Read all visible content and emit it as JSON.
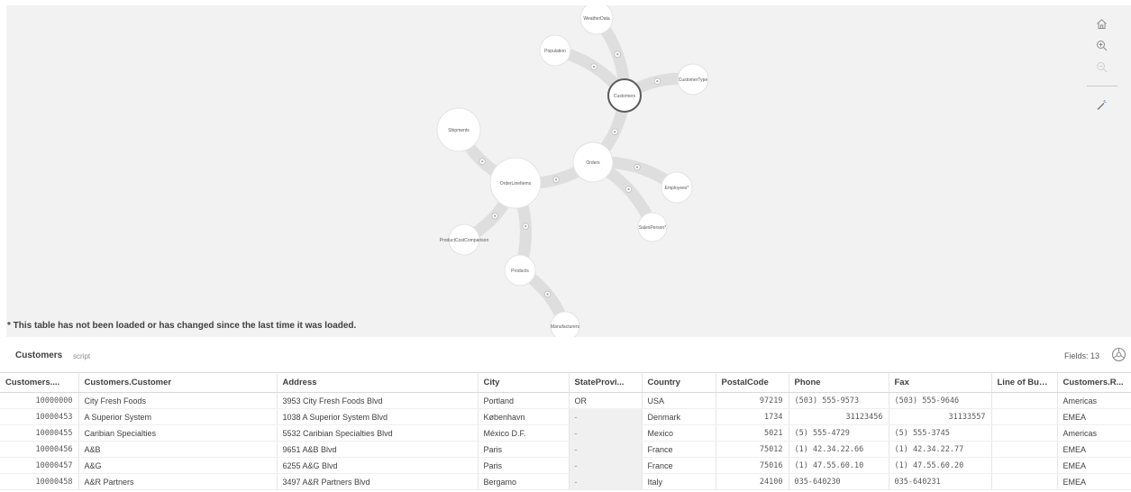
{
  "warning": "* This table has not been loaded or has changed since the last time it was loaded.",
  "model": {
    "nodes": [
      {
        "id": "weatherdata",
        "label": "WeatherData"
      },
      {
        "id": "population",
        "label": "Population"
      },
      {
        "id": "customers",
        "label": "Customers",
        "selected": true
      },
      {
        "id": "customertype",
        "label": "CustomerType"
      },
      {
        "id": "shipments",
        "label": "Shipments"
      },
      {
        "id": "orders",
        "label": "Orders"
      },
      {
        "id": "orderlineitems",
        "label": "OrderLineItems"
      },
      {
        "id": "employees",
        "label": "Employees*"
      },
      {
        "id": "salesperson",
        "label": "SalesPerson*"
      },
      {
        "id": "productcostcomparison",
        "label": "ProductCostComparison"
      },
      {
        "id": "products",
        "label": "Products"
      },
      {
        "id": "manufacturers",
        "label": "Manufacturers"
      }
    ],
    "links": [
      [
        "weatherdata",
        "customers"
      ],
      [
        "population",
        "customers"
      ],
      [
        "customers",
        "customertype"
      ],
      [
        "customers",
        "orders"
      ],
      [
        "orders",
        "employees"
      ],
      [
        "orders",
        "salesperson"
      ],
      [
        "orders",
        "orderlineitems"
      ],
      [
        "orderlineitems",
        "shipments"
      ],
      [
        "orderlineitems",
        "productcostcomparison"
      ],
      [
        "orderlineitems",
        "products"
      ],
      [
        "products",
        "manufacturers"
      ]
    ]
  },
  "toolbar": [
    {
      "name": "home-icon"
    },
    {
      "name": "zoom-in-icon"
    },
    {
      "name": "zoom-out-icon"
    },
    {
      "name": "magic-wand-icon"
    }
  ],
  "preview": {
    "table_name": "Customers",
    "source": "script",
    "fields_label": "Fields: 13",
    "columns": [
      "Customers....",
      "Customers.Customer",
      "Address",
      "City",
      "StateProvi...",
      "Country",
      "PostalCode",
      "Phone",
      "Fax",
      "Line of Busi...",
      "Customers.R..."
    ],
    "rows": [
      [
        "10000000",
        "City Fresh Foods",
        "3953 City Fresh Foods Blvd",
        "Portland",
        "OR",
        "USA",
        "97219",
        "(503) 555-9573",
        "(503) 555-9646",
        "",
        "Americas"
      ],
      [
        "10000453",
        "A Superior System",
        "1038 A Superior System Blvd",
        "København",
        "-",
        "Denmark",
        "1734",
        "31123456",
        "31133557",
        "",
        "EMEA"
      ],
      [
        "10000455",
        "Caribian Specialties",
        "5532 Caribian Specialties Blvd",
        "México D.F.",
        "-",
        "Mexico",
        "5021",
        "(5) 555-4729",
        "(5) 555-3745",
        "",
        "Americas"
      ],
      [
        "10000456",
        "A&B",
        "9651 A&B Blvd",
        "Paris",
        "-",
        "France",
        "75012",
        "(1) 42.34.22.66",
        "(1) 42.34.22.77",
        "",
        "EMEA"
      ],
      [
        "10000457",
        "A&G",
        "6255 A&G Blvd",
        "Paris",
        "-",
        "France",
        "75016",
        "(1) 47.55.60.10",
        "(1) 47.55.60.20",
        "",
        "EMEA"
      ],
      [
        "10000458",
        "A&R Partners",
        "3497 A&R Partners Blvd",
        "Bergamo",
        "-",
        "Italy",
        "24100",
        "035-640230",
        "035-640231",
        "",
        "EMEA"
      ]
    ]
  }
}
